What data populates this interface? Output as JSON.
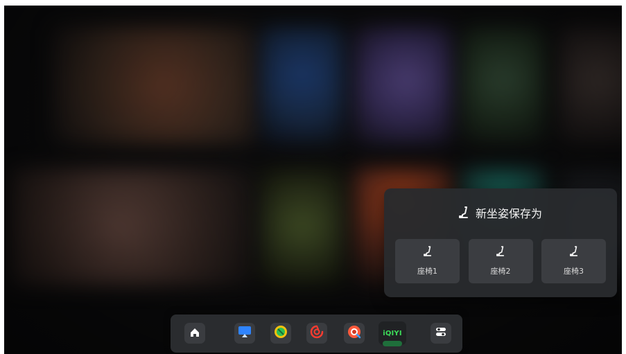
{
  "panel": {
    "title": "新坐姿保存为",
    "icon": "seat-icon",
    "seats": [
      {
        "label": "座椅1",
        "icon": "seat-icon"
      },
      {
        "label": "座椅2",
        "icon": "seat-icon"
      },
      {
        "label": "座椅3",
        "icon": "seat-icon"
      }
    ]
  },
  "dock": {
    "items": [
      {
        "name": "home",
        "icon": "home-icon"
      },
      {
        "name": "screen-cast",
        "icon": "cast-icon"
      },
      {
        "name": "app-green",
        "icon": "green-app-icon"
      },
      {
        "name": "netease-music",
        "icon": "music-app-icon"
      },
      {
        "name": "app-red",
        "icon": "red-app-icon"
      },
      {
        "name": "iqiyi",
        "icon": "iqiyi-icon",
        "logo_text": "iQIYI"
      },
      {
        "name": "settings-toggle",
        "icon": "toggle-icon"
      }
    ]
  },
  "colors": {
    "panel_bg": "#292b2e",
    "button_bg": "#3b3d41",
    "dock_bg": "#2a2c2f",
    "iqiyi_green": "#3ddc5a"
  }
}
